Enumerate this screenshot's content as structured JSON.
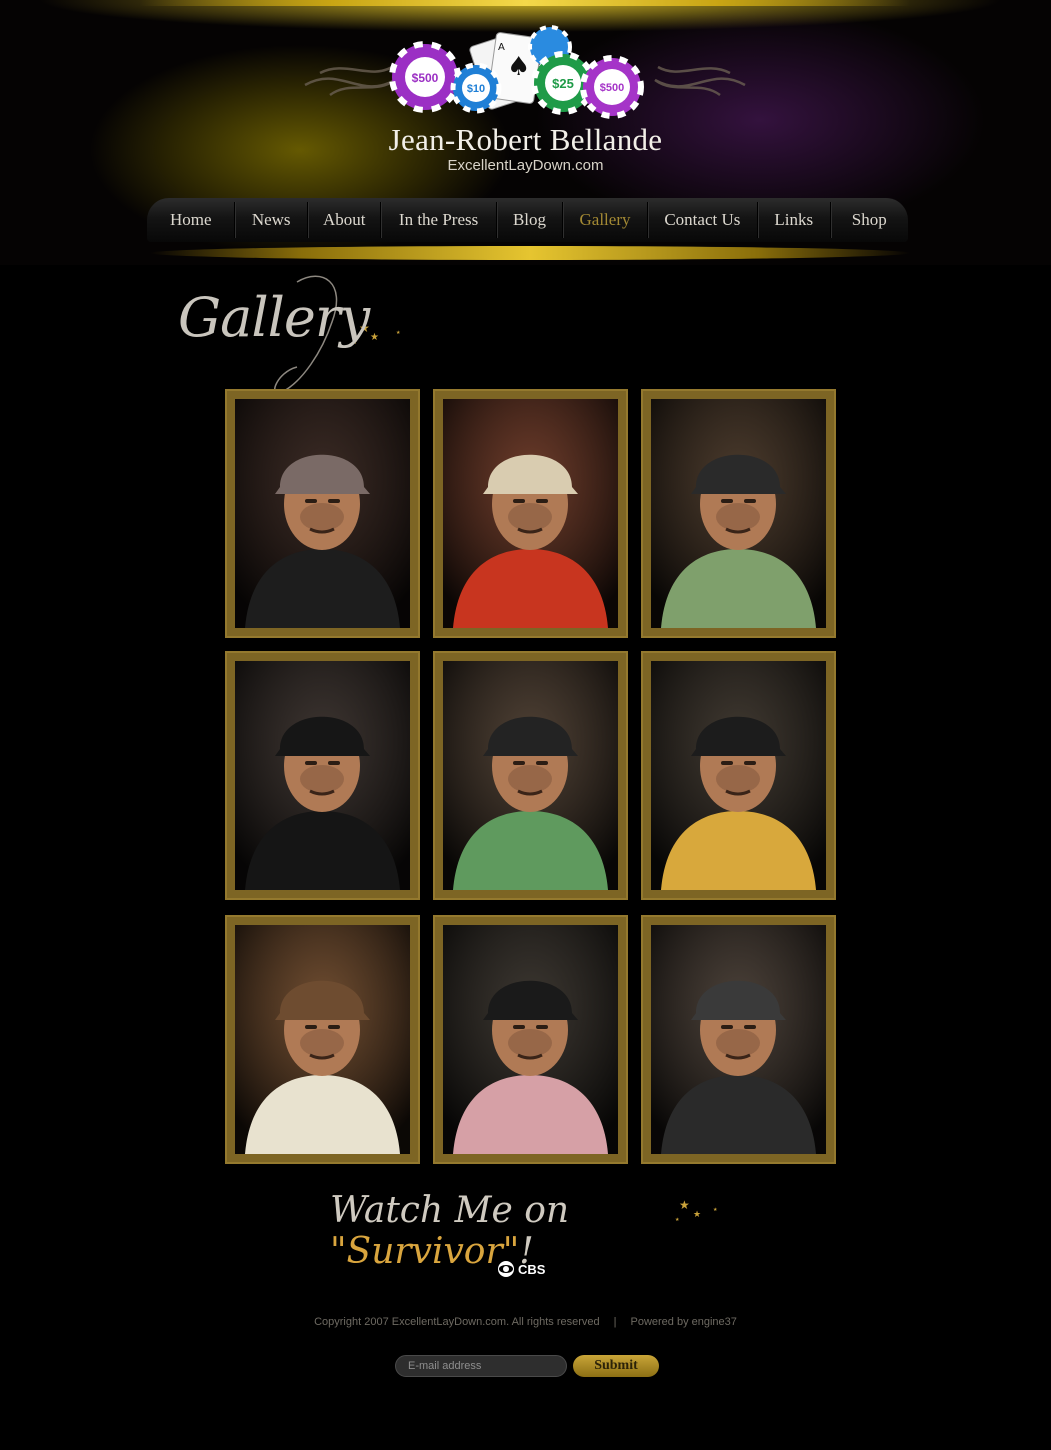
{
  "header": {
    "title": "Jean-Robert Bellande",
    "subtitle": "ExcellentLayDown.com",
    "chips": [
      "$500",
      "$10",
      "$25",
      "$500"
    ]
  },
  "nav": {
    "items": [
      {
        "label": "Home",
        "name": "nav-home"
      },
      {
        "label": "News",
        "name": "nav-news"
      },
      {
        "label": "About",
        "name": "nav-about"
      },
      {
        "label": "In the Press",
        "name": "nav-in-the-press"
      },
      {
        "label": "Blog",
        "name": "nav-blog"
      },
      {
        "label": "Gallery",
        "name": "nav-gallery",
        "active": true
      },
      {
        "label": "Contact Us",
        "name": "nav-contact-us"
      },
      {
        "label": "Links",
        "name": "nav-links"
      },
      {
        "label": "Shop",
        "name": "nav-shop"
      }
    ]
  },
  "page": {
    "heading": "Gallery"
  },
  "gallery": {
    "photos": [
      {
        "bg": "#3a2a24",
        "shirt": "#1d1d1d",
        "cap": "#7a6a66"
      },
      {
        "bg": "#6b3b2a",
        "shirt": "#c8351f",
        "cap": "#d9ccb0"
      },
      {
        "bg": "#4a3a2c",
        "shirt": "#7fa06c",
        "cap": "#2a2a2a"
      },
      {
        "bg": "#3c3430",
        "shirt": "#151515",
        "cap": "#161616"
      },
      {
        "bg": "#4e4034",
        "shirt": "#5f9a5e",
        "cap": "#232323"
      },
      {
        "bg": "#3f3830",
        "shirt": "#d8a83c",
        "cap": "#1c1c1c"
      },
      {
        "bg": "#6e4c30",
        "shirt": "#e8e2cf",
        "cap": "#6e4c30"
      },
      {
        "bg": "#3b3630",
        "shirt": "#d6a0a6",
        "cap": "#1a1a1a"
      },
      {
        "bg": "#4a4038",
        "shirt": "#2a2a2a",
        "cap": "#3a3a3a"
      }
    ]
  },
  "promo": {
    "prefix": "Watch Me on ",
    "show": "\"Survivor\"",
    "suffix": "!",
    "network": "CBS"
  },
  "footer": {
    "copyright": "Copyright 2007 ExcellentLayDown.com. All rights reserved",
    "separator": "|",
    "powered_by": "Powered by engine37"
  },
  "newsletter": {
    "email_placeholder": "E-mail address",
    "submit_label": "Submit"
  },
  "colors": {
    "gold_frame": "#7d6524",
    "nav_active": "#a48a34",
    "survivor_gold": "#d9a53e",
    "chip_purple": "#9b2fc4",
    "chip_blue": "#1f7fd6",
    "chip_green": "#1f9b48"
  }
}
